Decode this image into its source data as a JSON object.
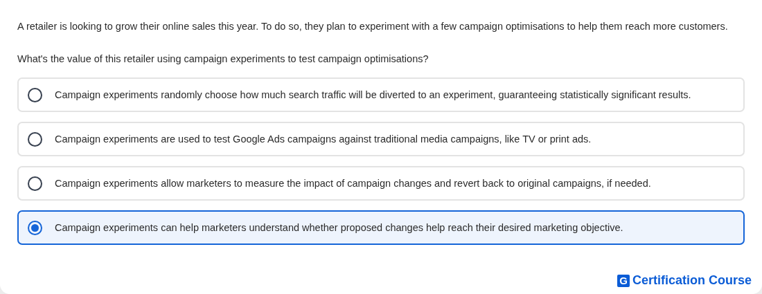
{
  "scenario": "A retailer is looking to grow their online sales this year. To do so, they plan to experiment with a few campaign optimisations to help them reach more customers.",
  "question": "What's the value of this retailer using campaign experiments to test campaign optimisations?",
  "options": [
    {
      "text": "Campaign experiments randomly choose how much search traffic will be diverted to an experiment, guaranteeing statistically significant results.",
      "selected": false
    },
    {
      "text": "Campaign experiments are used to test Google Ads campaigns against traditional media campaigns, like TV or print ads.",
      "selected": false
    },
    {
      "text": "Campaign experiments allow marketers to measure the impact of campaign changes and revert back to original campaigns, if needed.",
      "selected": false
    },
    {
      "text": "Campaign experiments can help marketers understand whether proposed changes help reach their desired marketing objective.",
      "selected": true
    }
  ],
  "brand": {
    "mark": "G",
    "name": "Certification Course"
  }
}
